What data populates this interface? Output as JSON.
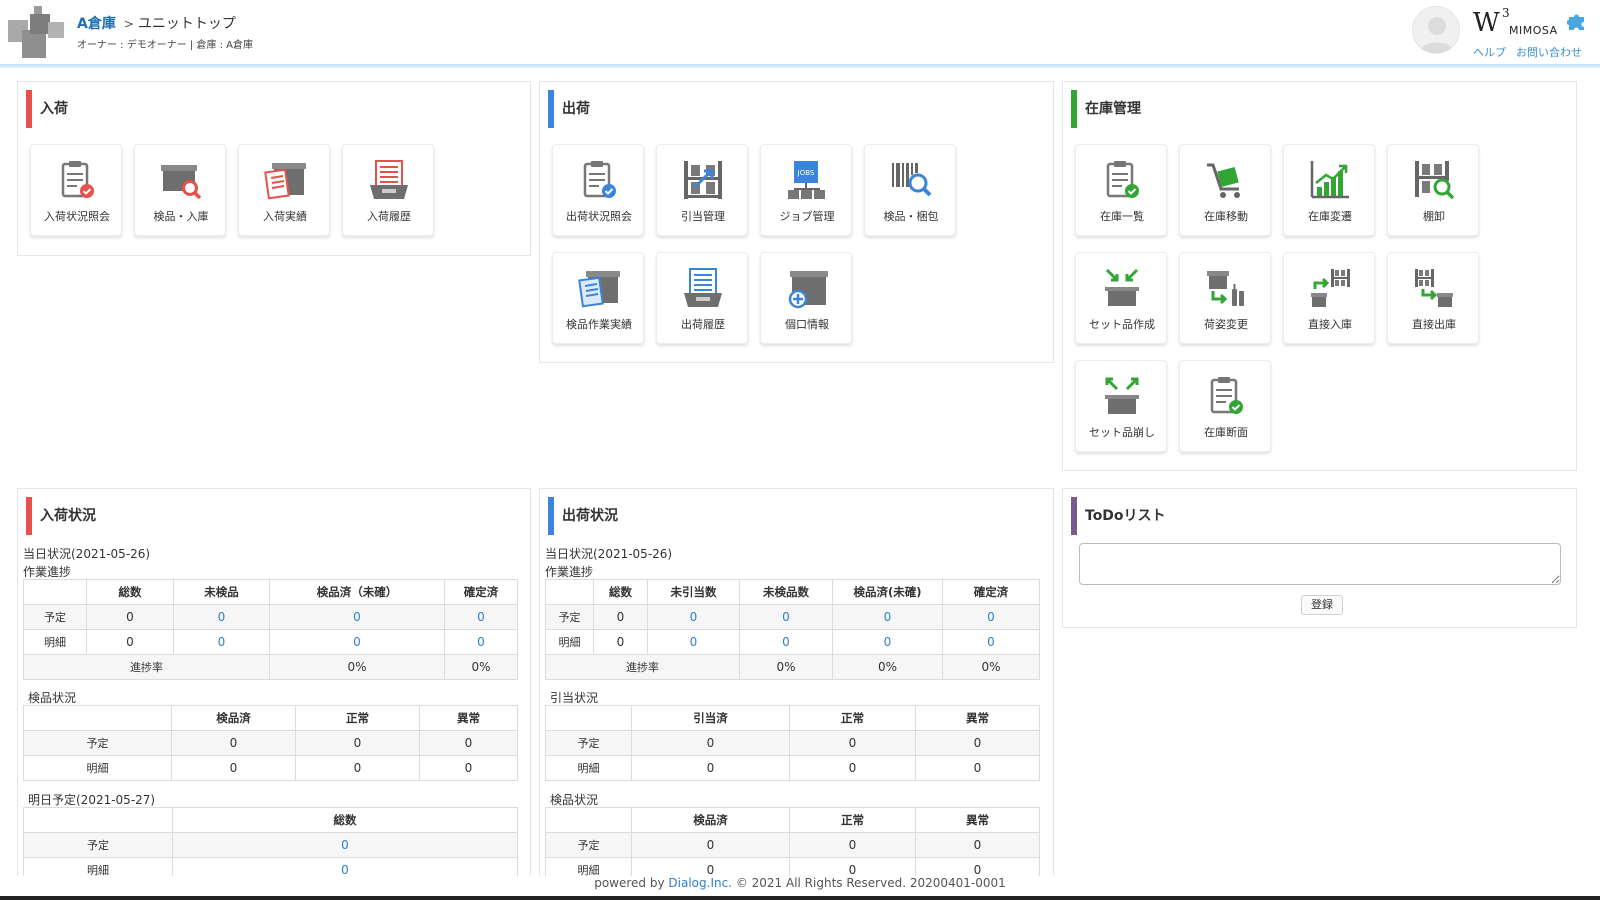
{
  "header": {
    "home_link": "A倉庫",
    "separator": ">",
    "page_title": "ユニットトップ",
    "subinfo": "オーナー : デモオーナー | 倉庫 : A倉庫",
    "brand_w": "W",
    "brand_sup": "3",
    "brand_name": "MIMOSA",
    "help": "ヘルプ",
    "contact": "お問い合わせ"
  },
  "colors": {
    "inbound": "#e8504a",
    "outbound": "#3a85d9",
    "stock": "#33a535",
    "todo": "#7a5a8c",
    "link": "#2f80c9"
  },
  "inbound": {
    "title": "入荷",
    "tiles": [
      {
        "label": "入荷状況照会",
        "icon": "clipboard-check-red-icon"
      },
      {
        "label": "検品・入庫",
        "icon": "box-search-icon"
      },
      {
        "label": "入荷実績",
        "icon": "box-document-red-icon"
      },
      {
        "label": "入荷履歴",
        "icon": "tray-history-red-icon"
      }
    ]
  },
  "outbound": {
    "title": "出荷",
    "tiles": [
      {
        "label": "出荷状況照会",
        "icon": "clipboard-check-blue-icon"
      },
      {
        "label": "引当管理",
        "icon": "shelf-arrow-icon"
      },
      {
        "label": "ジョブ管理",
        "icon": "jobs-icon"
      },
      {
        "label": "検品・梱包",
        "icon": "barcode-search-icon"
      },
      {
        "label": "検品作業実績",
        "icon": "box-document-blue-icon"
      },
      {
        "label": "出荷履歴",
        "icon": "tray-history-blue-icon"
      },
      {
        "label": "個口情報",
        "icon": "box-plus-icon"
      }
    ]
  },
  "stock": {
    "title": "在庫管理",
    "tiles": [
      {
        "label": "在庫一覧",
        "icon": "clipboard-check-green-icon"
      },
      {
        "label": "在庫移動",
        "icon": "cart-icon"
      },
      {
        "label": "在庫変遷",
        "icon": "bar-chart-icon"
      },
      {
        "label": "棚卸",
        "icon": "shelf-search-icon"
      },
      {
        "label": "セット品作成",
        "icon": "box-in-arrows-icon"
      },
      {
        "label": "荷姿変更",
        "icon": "package-change-icon"
      },
      {
        "label": "直接入庫",
        "icon": "direct-in-icon"
      },
      {
        "label": "直接出庫",
        "icon": "direct-out-icon"
      },
      {
        "label": "セット品崩し",
        "icon": "box-out-arrows-icon"
      },
      {
        "label": "在庫断面",
        "icon": "clipboard-check-green2-icon"
      }
    ]
  },
  "inbound_status": {
    "title": "入荷状況",
    "today": "当日状況(2021-05-26)",
    "progress_label": "作業進捗",
    "progress_headers": [
      "",
      "総数",
      "未検品",
      "検品済（未確）",
      "確定済"
    ],
    "rows": [
      {
        "label": "予定",
        "values": [
          "0",
          "0",
          "0",
          "0"
        ]
      },
      {
        "label": "明細",
        "values": [
          "0",
          "0",
          "0",
          "0"
        ]
      }
    ],
    "rate_label": "進捗率",
    "rate_values": [
      "0%",
      "0%"
    ],
    "inspect_label": "検品状況",
    "inspect_headers": [
      "",
      "検品済",
      "正常",
      "異常"
    ],
    "inspect_rows": [
      {
        "label": "予定",
        "values": [
          "0",
          "0",
          "0"
        ]
      },
      {
        "label": "明細",
        "values": [
          "0",
          "0",
          "0"
        ]
      }
    ],
    "tomorrow": "明日予定(2021-05-27)",
    "tomorrow_headers": [
      "",
      "総数"
    ],
    "tomorrow_rows": [
      {
        "label": "予定",
        "values": [
          "0"
        ]
      },
      {
        "label": "明細",
        "values": [
          "0"
        ]
      }
    ]
  },
  "outbound_status": {
    "title": "出荷状況",
    "today": "当日状況(2021-05-26)",
    "progress_label": "作業進捗",
    "progress_headers": [
      "",
      "総数",
      "未引当数",
      "未検品数",
      "検品済(未確)",
      "確定済"
    ],
    "rows": [
      {
        "label": "予定",
        "values": [
          "0",
          "0",
          "0",
          "0",
          "0"
        ]
      },
      {
        "label": "明細",
        "values": [
          "0",
          "0",
          "0",
          "0",
          "0"
        ]
      }
    ],
    "rate_label": "進捗率",
    "rate_values": [
      "0%",
      "0%",
      "0%"
    ],
    "alloc_label": "引当状況",
    "alloc_headers": [
      "",
      "引当済",
      "正常",
      "異常"
    ],
    "alloc_rows": [
      {
        "label": "予定",
        "values": [
          "0",
          "0",
          "0"
        ]
      },
      {
        "label": "明細",
        "values": [
          "0",
          "0",
          "0"
        ]
      }
    ],
    "inspect_label": "検品状況",
    "inspect_headers": [
      "",
      "検品済",
      "正常",
      "異常"
    ],
    "inspect_rows": [
      {
        "label": "予定",
        "values": [
          "0",
          "0",
          "0"
        ]
      },
      {
        "label": "明細",
        "values": [
          "0",
          "0",
          "0"
        ]
      }
    ]
  },
  "todo": {
    "title": "ToDoリスト",
    "input_value": "",
    "submit": "登録"
  },
  "footer": {
    "prefix": "powered by ",
    "company": "Dialog.Inc.",
    "suffix": " © 2021 All Rights Reserved. 20200401-0001"
  }
}
